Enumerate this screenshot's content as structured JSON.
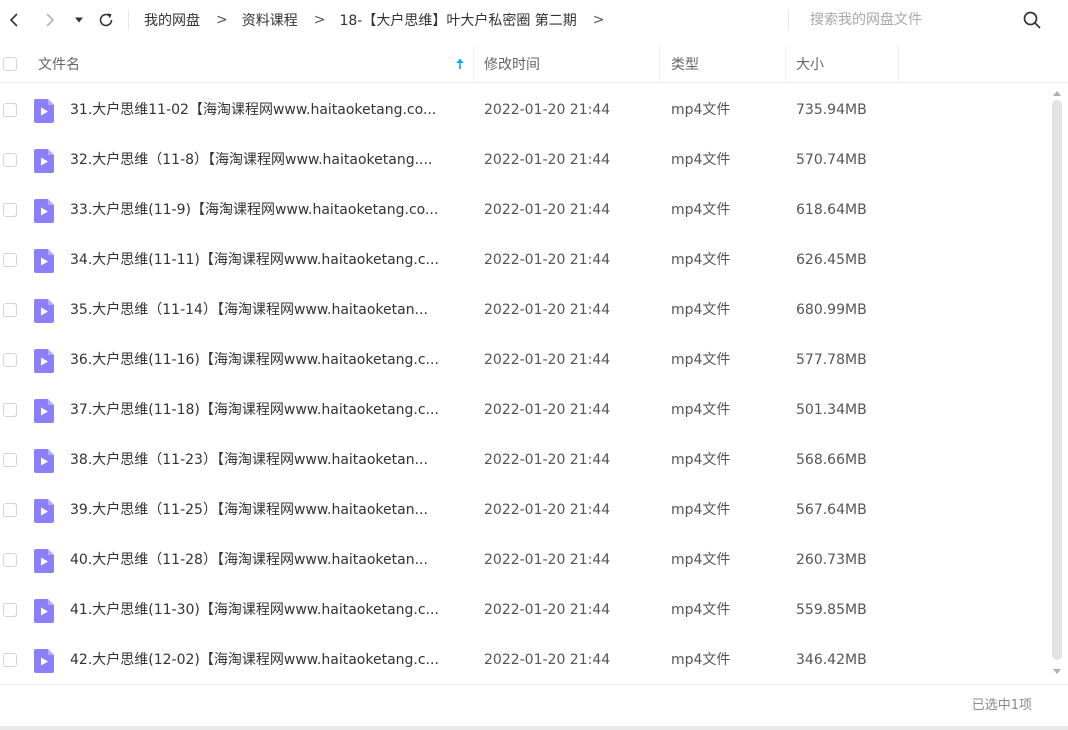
{
  "breadcrumb": {
    "items": [
      "我的网盘",
      "资料课程",
      "18-【大户思维】叶大户私密圈 第二期"
    ],
    "separator": ">"
  },
  "search": {
    "placeholder": "搜索我的网盘文件"
  },
  "columns": {
    "name": "文件名",
    "modified": "修改时间",
    "type": "类型",
    "size": "大小"
  },
  "files": [
    {
      "name": "31.大户思维11-02【海淘课程网www.haitaoketang.co...",
      "modified": "2022-01-20 21:44",
      "type": "mp4文件",
      "size": "735.94MB"
    },
    {
      "name": "32.大户思维（11-8）【海淘课程网www.haitaoketang....",
      "modified": "2022-01-20 21:44",
      "type": "mp4文件",
      "size": "570.74MB"
    },
    {
      "name": "33.大户思维(11-9)【海淘课程网www.haitaoketang.co...",
      "modified": "2022-01-20 21:44",
      "type": "mp4文件",
      "size": "618.64MB"
    },
    {
      "name": "34.大户思维(11-11)【海淘课程网www.haitaoketang.c...",
      "modified": "2022-01-20 21:44",
      "type": "mp4文件",
      "size": "626.45MB"
    },
    {
      "name": "35.大户思维（11-14）【海淘课程网www.haitaoketan...",
      "modified": "2022-01-20 21:44",
      "type": "mp4文件",
      "size": "680.99MB"
    },
    {
      "name": "36.大户思维(11-16)【海淘课程网www.haitaoketang.c...",
      "modified": "2022-01-20 21:44",
      "type": "mp4文件",
      "size": "577.78MB"
    },
    {
      "name": "37.大户思维(11-18)【海淘课程网www.haitaoketang.c...",
      "modified": "2022-01-20 21:44",
      "type": "mp4文件",
      "size": "501.34MB"
    },
    {
      "name": "38.大户思维（11-23）【海淘课程网www.haitaoketan...",
      "modified": "2022-01-20 21:44",
      "type": "mp4文件",
      "size": "568.66MB"
    },
    {
      "name": "39.大户思维（11-25）【海淘课程网www.haitaoketan...",
      "modified": "2022-01-20 21:44",
      "type": "mp4文件",
      "size": "567.64MB"
    },
    {
      "name": "40.大户思维（11-28）【海淘课程网www.haitaoketan...",
      "modified": "2022-01-20 21:44",
      "type": "mp4文件",
      "size": "260.73MB"
    },
    {
      "name": "41.大户思维(11-30)【海淘课程网www.haitaoketang.c...",
      "modified": "2022-01-20 21:44",
      "type": "mp4文件",
      "size": "559.85MB"
    },
    {
      "name": "42.大户思维(12-02)【海淘课程网www.haitaoketang.c...",
      "modified": "2022-01-20 21:44",
      "type": "mp4文件",
      "size": "346.42MB"
    }
  ],
  "status": {
    "selection": "已选中1项"
  },
  "colors": {
    "accent": "#06a7ff",
    "file_icon": "#8b80f9",
    "text": "#333333"
  },
  "icons": {
    "back": "chevron-left-icon",
    "forward": "chevron-right-icon",
    "history": "caret-down-icon",
    "refresh": "refresh-icon",
    "search": "search-icon",
    "sort": "arrow-up-icon",
    "video_file": "video-file-icon"
  }
}
